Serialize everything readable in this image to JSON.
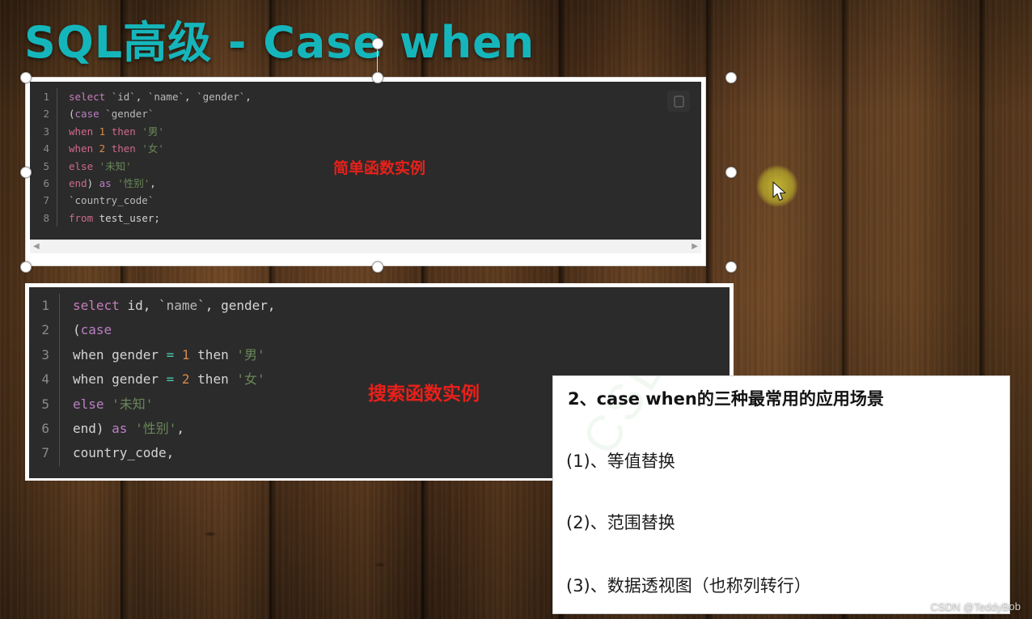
{
  "slide": {
    "title": "SQL高级  - Case when",
    "title_color": "#15b6bb",
    "background": "dark-wood-planks",
    "credit": "CSDN @TeddyBob"
  },
  "code_block_1": {
    "language": "sql",
    "selected": true,
    "copy_icon": "copy-icon",
    "line_numbers": [
      "1",
      "2",
      "3",
      "4",
      "5",
      "6",
      "7",
      "8"
    ],
    "lines": [
      "select `id`, `name`, `gender`,",
      "(case `gender`",
      "when 1 then '男'",
      "when 2 then '女'",
      "else '未知'",
      "end) as '性别',",
      "`country_code`",
      "from test_user;"
    ],
    "annotation": "简单函数实例",
    "annotation_color": "#e8201a",
    "scrollbar": {
      "left_arrow": "◀",
      "right_arrow": "▶"
    }
  },
  "code_block_2": {
    "language": "sql",
    "selected": false,
    "line_numbers": [
      "1",
      "2",
      "3",
      "4",
      "5",
      "6",
      "7"
    ],
    "lines": [
      "select id, `name`, gender,",
      "(case",
      "when gender = 1 then '男'",
      "when gender = 2 then '女'",
      "else '未知'",
      "end) as '性别',",
      "country_code,"
    ],
    "annotation": "搜索函数实例",
    "annotation_color": "#e8201a"
  },
  "panel": {
    "title": "2、case when的三种最常用的应用场景",
    "items": [
      "(1)、等值替换",
      "(2)、范围替换",
      "(3)、数据透视图（也称列转行）"
    ],
    "watermark": "CSDN"
  },
  "cursor": {
    "icon": "mouse-pointer-icon",
    "highlight_color": "#d6ce34"
  }
}
